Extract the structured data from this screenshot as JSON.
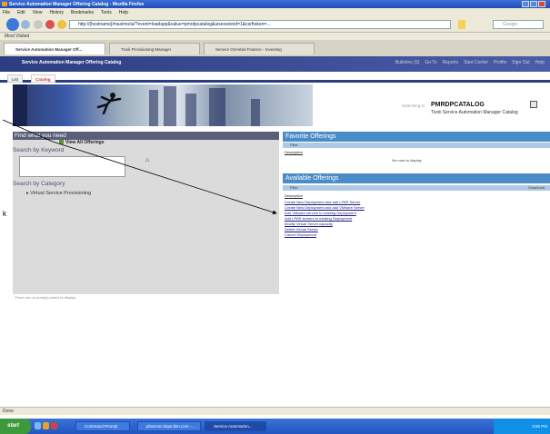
{
  "window": {
    "title": "Service Automation Manager Offering Catalog - Mozilla Firefox"
  },
  "menu": [
    "File",
    "Edit",
    "View",
    "History",
    "Bookmarks",
    "Tools",
    "Help"
  ],
  "nav": {
    "url": "http://[hostname]/maximo/ui/?event=loadapp&value=pmrdpcatalog&uisessionid=1&csrftoken=...",
    "search_placeholder": "Google"
  },
  "bookmarks": {
    "item": "Most Visited"
  },
  "tabs": [
    {
      "label": "Service Automation Manager Off..."
    },
    {
      "label": "Tivoli Provisioning Manager"
    },
    {
      "label": "Service Oriented Finance - Investing"
    }
  ],
  "app": {
    "title": "Service Automation Manager Offering Catalog",
    "links": [
      "Bulletins (0)",
      "Go To",
      "Reports",
      "Start Center",
      "Profile",
      "Sign Out",
      "Help"
    ],
    "subtabs": [
      "List",
      "Catalog"
    ]
  },
  "catalog": {
    "searching_label": "Searching in",
    "name": "PMRDPCATALOG",
    "subtitle": "Tivoli Service Automation Manager Catalog"
  },
  "left": {
    "header": "Find what you need",
    "view_all": "View All Offerings",
    "search_keyword": "Search by Keyword",
    "search_category": "Search by Category",
    "category_item": "Virtual Service Provisioning",
    "no_prefs": "There are no (empty) select to display."
  },
  "favorites": {
    "header": "Favorite Offerings",
    "tool": "Filter",
    "column": "Description",
    "no_rows": "No rows to display"
  },
  "available": {
    "header": "Available Offerings",
    "tool": "Filter",
    "download": "Download",
    "column": "Description",
    "items": [
      "Create New Deployment and add LPAR Server",
      "Create New Deployment and add VMware Server",
      "Add VMware servers to existing Deployment",
      "Add LPAR servers to existing Deployment",
      "Modify Virtual Server capacity",
      "Delete Virtual Server",
      "Cancel Deployment"
    ]
  },
  "status": {
    "text": "Done"
  },
  "taskbar": {
    "start": "start",
    "tasks": [
      "Command Prompt",
      "pharmon.itsps.ibm.com -...",
      "Service Automation..."
    ],
    "clock": "3:55 PM"
  }
}
